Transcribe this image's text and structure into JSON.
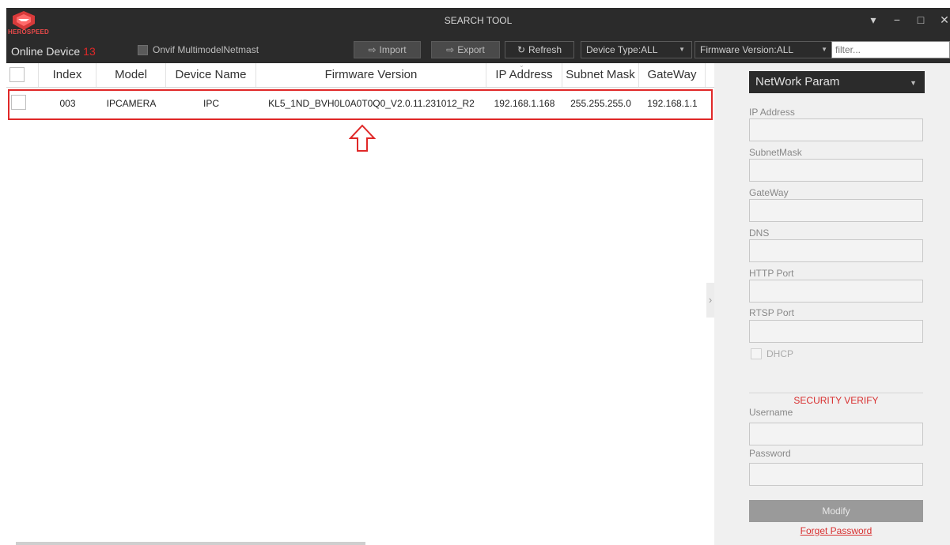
{
  "window": {
    "title": "SEARCH TOOL",
    "brand": "HEROSPEED",
    "controls": [
      "▾",
      "−",
      "□",
      "✕"
    ]
  },
  "toolbar": {
    "online_label": "Online Device",
    "online_count": "13",
    "onvif_label": "Onvif MultimodelNetmast",
    "import_label": "Import",
    "export_label": "Export",
    "refresh_label": "Refresh",
    "device_type": "Device Type:ALL",
    "firmware_version": "Firmware Version:ALL",
    "filter_placeholder": "filter..."
  },
  "table": {
    "headers": [
      "Index",
      "Model",
      "Device Name",
      "Firmware Version",
      "IP Address",
      "Subnet Mask",
      "GateWay"
    ],
    "rows": [
      {
        "index": "003",
        "model": "IPCAMERA",
        "device_name": "IPC",
        "firmware": "KL5_1ND_BVH0L0A0T0Q0_V2.0.11.231012_R2",
        "ip": "192.168.1.168",
        "subnet": "255.255.255.0",
        "gateway": "192.168.1.1"
      }
    ]
  },
  "panel": {
    "dropdown": "NetWork Param",
    "fields": [
      "IP Address",
      "SubnetMask",
      "GateWay",
      "DNS",
      "HTTP Port",
      "RTSP Port"
    ],
    "dhcp_label": "DHCP",
    "security_title": "SECURITY VERIFY",
    "username_label": "Username",
    "password_label": "Password",
    "modify_label": "Modify",
    "forget_label": "Forget Password"
  },
  "colors": {
    "title_bg": "#2b2b2b",
    "accent_red": "#e02828",
    "panel_bg": "#f0f0f0"
  }
}
